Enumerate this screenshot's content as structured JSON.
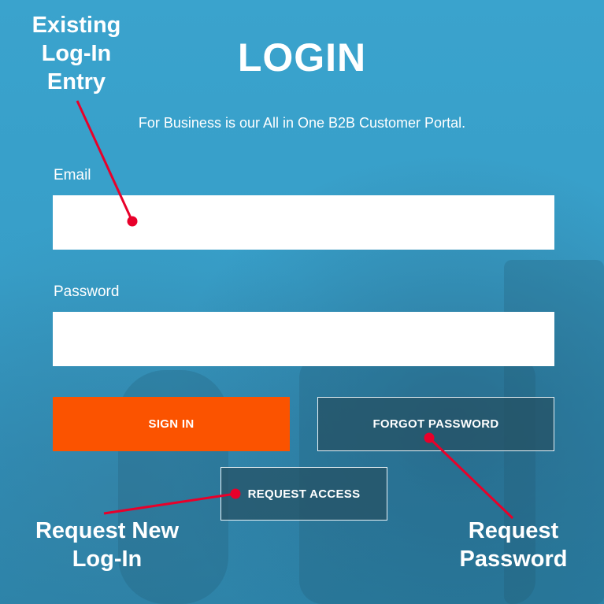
{
  "page": {
    "title": "LOGIN",
    "subtitle": "For Business is our All in One B2B Customer Portal."
  },
  "form": {
    "email_label": "Email",
    "email_value": "",
    "password_label": "Password",
    "password_value": ""
  },
  "buttons": {
    "sign_in": "SIGN IN",
    "forgot_password": "FORGOT PASSWORD",
    "request_access": "REQUEST ACCESS"
  },
  "callouts": {
    "existing_login": [
      "Existing",
      "Log-In",
      "Entry"
    ],
    "request_new": [
      "Request New",
      "Log-In"
    ],
    "request_password": [
      "Request",
      "Password"
    ]
  },
  "colors": {
    "background": "#3aa2cc",
    "sign_in_button": "#fb5300",
    "outline_button": "#265062",
    "annotation_arrow": "#e8002a"
  }
}
